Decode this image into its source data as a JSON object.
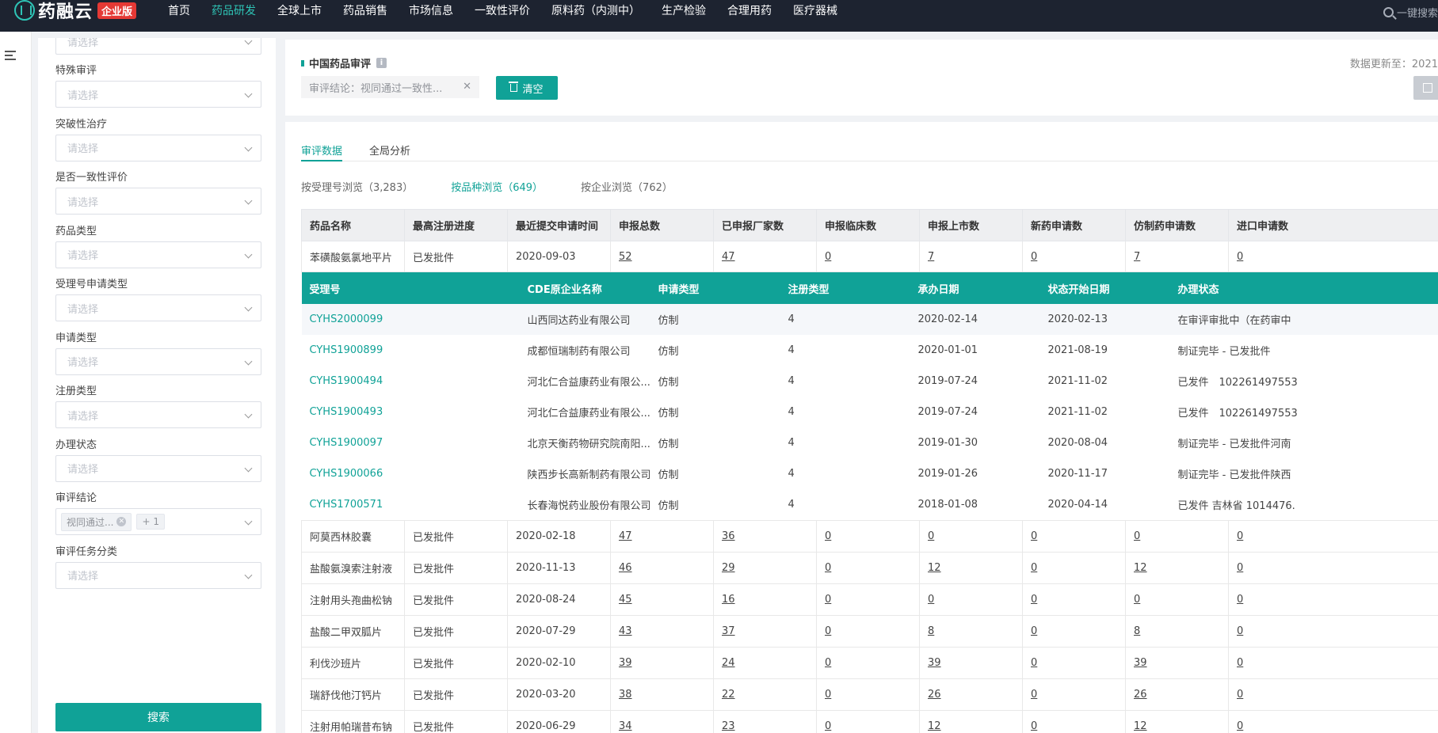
{
  "nav": {
    "brand": "药融云",
    "badge": "企业版",
    "items": [
      "首页",
      "药品研发",
      "全球上市",
      "药品销售",
      "市场信息",
      "一致性评价",
      "原料药（内测中）",
      "生产检验",
      "合理用药",
      "医疗器械"
    ],
    "active_index": 1,
    "search_label": "一键搜索"
  },
  "filters": {
    "top_placeholder": "请选择",
    "groups": [
      {
        "label": "特殊审评",
        "placeholder": "请选择"
      },
      {
        "label": "突破性治疗",
        "placeholder": "请选择"
      },
      {
        "label": "是否一致性评价",
        "placeholder": "请选择"
      },
      {
        "label": "药品类型",
        "placeholder": "请选择"
      },
      {
        "label": "受理号申请类型",
        "placeholder": "请选择"
      },
      {
        "label": "申请类型",
        "placeholder": "请选择"
      },
      {
        "label": "注册类型",
        "placeholder": "请选择"
      },
      {
        "label": "办理状态",
        "placeholder": "请选择"
      },
      {
        "label": "审评结论",
        "tag": "视同通过...",
        "more": "+ 1"
      },
      {
        "label": "审评任务分类",
        "placeholder": "请选择"
      }
    ],
    "search_button": "搜索"
  },
  "header": {
    "title": "中国药品审评",
    "condition_tag": "审评结论：视同通过一致性...",
    "clear_button": "清空",
    "updated": "数据更新至：2021"
  },
  "tabs": [
    "审评数据",
    "全局分析"
  ],
  "subtabs": [
    "按受理号浏览（3,283）",
    "按品种浏览（649）",
    "按企业浏览（762）"
  ],
  "table": {
    "columns": [
      "药品名称",
      "最高注册进度",
      "最近提交申请时间",
      "申报总数",
      "已申报厂家数",
      "申报临床数",
      "申报上市数",
      "新药申请数",
      "仿制药申请数",
      "进口申请数"
    ],
    "first_row": [
      "苯磺酸氨氯地平片",
      "已发批件",
      "2020-09-03",
      "52",
      "47",
      "0",
      "7",
      "0",
      "7",
      "0"
    ],
    "detail": {
      "columns": [
        "受理号",
        "CDE原企业名称",
        "申请类型",
        "注册类型",
        "承办日期",
        "状态开始日期",
        "办理状态"
      ],
      "rows": [
        [
          "CYHS2000099",
          "山西同达药业有限公司",
          "仿制",
          "4",
          "2020-02-14",
          "2020-02-13",
          "在审评审批中（在药审中"
        ],
        [
          "CYHS1900899",
          "成都恒瑞制药有限公司",
          "仿制",
          "4",
          "2020-01-01",
          "2021-08-19",
          "制证完毕 - 已发批件"
        ],
        [
          "CYHS1900494",
          "河北仁合益康药业有限公...",
          "仿制",
          "4",
          "2019-07-24",
          "2021-11-02",
          "已发件　102261497553"
        ],
        [
          "CYHS1900493",
          "河北仁合益康药业有限公...",
          "仿制",
          "4",
          "2019-07-24",
          "2021-11-02",
          "已发件　102261497553"
        ],
        [
          "CYHS1900097",
          "北京天衡药物研究院南阳...",
          "仿制",
          "4",
          "2019-01-30",
          "2020-08-04",
          "制证完毕 - 已发批件河南"
        ],
        [
          "CYHS1900066",
          "陕西步长高新制药有限公司",
          "仿制",
          "4",
          "2019-01-26",
          "2020-11-17",
          "制证完毕 - 已发批件陕西"
        ],
        [
          "CYHS1700571",
          "长春海悦药业股份有限公司",
          "仿制",
          "4",
          "2018-01-08",
          "2020-04-14",
          "已发件 吉林省 1014476."
        ]
      ]
    },
    "rows": [
      [
        "阿莫西林胶囊",
        "已发批件",
        "2020-02-18",
        "47",
        "36",
        "0",
        "0",
        "0",
        "0",
        "0"
      ],
      [
        "盐酸氨溴索注射液",
        "已发批件",
        "2020-11-13",
        "46",
        "29",
        "0",
        "12",
        "0",
        "12",
        "0"
      ],
      [
        "注射用头孢曲松钠",
        "已发批件",
        "2020-08-24",
        "45",
        "16",
        "0",
        "0",
        "0",
        "0",
        "0"
      ],
      [
        "盐酸二甲双胍片",
        "已发批件",
        "2020-07-29",
        "43",
        "37",
        "0",
        "8",
        "0",
        "8",
        "0"
      ],
      [
        "利伐沙班片",
        "已发批件",
        "2020-02-10",
        "39",
        "24",
        "0",
        "39",
        "0",
        "39",
        "0"
      ],
      [
        "瑞舒伐他汀钙片",
        "已发批件",
        "2020-03-20",
        "38",
        "22",
        "0",
        "26",
        "0",
        "26",
        "0"
      ],
      [
        "注射用帕瑞昔布钠",
        "已发批件",
        "2020-06-29",
        "34",
        "23",
        "0",
        "12",
        "0",
        "12",
        "0"
      ]
    ]
  }
}
